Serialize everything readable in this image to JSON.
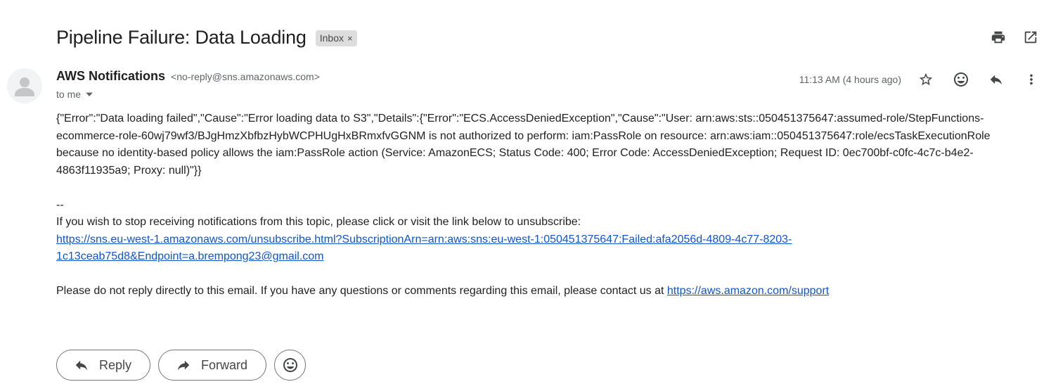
{
  "header": {
    "subject": "Pipeline Failure: Data Loading",
    "label": "Inbox",
    "label_close": "×",
    "actions": [
      "print-icon",
      "open-in-new-window-icon"
    ]
  },
  "message": {
    "sender_name": "AWS Notifications",
    "sender_email": "<no-reply@sns.amazonaws.com>",
    "to": "to me",
    "timestamp": "11:13 AM (4 hours ago)",
    "icons": [
      "star-icon",
      "emoji-icon",
      "reply-icon",
      "more-vertical-icon"
    ],
    "body_error": "{\"Error\":\"Data loading failed\",\"Cause\":\"Error loading data to S3\",\"Details\":{\"Error\":\"ECS.AccessDeniedException\",\"Cause\":\"User: arn:aws:sts::050451375647:assumed-role/StepFunctions-ecommerce-role-60wj79wf3/BJgHmzXbfbzHybWCPHUgHxBRmxfvGGNM is not authorized to perform: iam:PassRole on resource: arn:aws:iam::050451375647:role/ecsTaskExecutionRole because no identity-based policy allows the iam:PassRole action (Service: AmazonECS; Status Code: 400; Error Code: AccessDeniedException; Request ID: 0ec700bf-c0fc-4c7c-b4e2-4863f11935a9; Proxy: null)\"}}",
    "separator": "--",
    "unsubscribe_text": "If you wish to stop receiving notifications from this topic, please click or visit the link below to unsubscribe:",
    "unsubscribe_link": "https://sns.eu-west-1.amazonaws.com/unsubscribe.html?SubscriptionArn=arn:aws:sns:eu-west-1:050451375647:Failed:afa2056d-4809-4c77-8203-1c13ceab75d8&Endpoint=a.brempong23@gmail.com",
    "footer_text": "Please do not reply directly to this email. If you have any questions or comments regarding this email, please contact us at ",
    "footer_link": "https://aws.amazon.com/support"
  },
  "actions": {
    "reply": "Reply",
    "forward": "Forward"
  }
}
